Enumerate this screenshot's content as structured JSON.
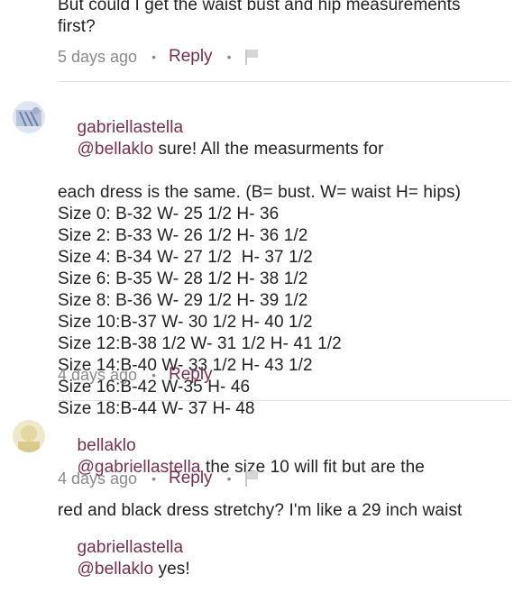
{
  "top_comment": {
    "text_partial_line": "But could I get the waist bust and hip measurements",
    "text_line2": "first?",
    "age": "5 days ago",
    "reply_label": "Reply"
  },
  "comment1": {
    "username": "gabriellastella",
    "mention": "@bellaklo",
    "text_first": " sure! All the measurments for",
    "text_second": "each dress is the same. (B= bust. W= waist H= hips)",
    "sizes": [
      "Size 0: B-32 W- 25 1/2 H- 36",
      "Size 2: B-33 W- 26 1/2 H- 36 1/2",
      "Size 4: B-34 W- 27 1/2  H- 37 1/2",
      "Size 6: B-35 W- 28 1/2 H- 38 1/2",
      "Size 8: B-36 W- 29 1/2 H- 39 1/2",
      "Size 10:B-37 W- 30 1/2 H- 40 1/2",
      "Size 12:B-38 1/2 W- 31 1/2 H- 41 1/2",
      "Size 14:B-40 W- 33 1/2 H- 43 1/2",
      "Size 16:B-42 W-35 H- 46",
      "Size 18:B-44 W- 37 H- 48"
    ],
    "age": "4 days ago",
    "reply_label": "Reply"
  },
  "comment2": {
    "username": "bellaklo",
    "mention": "@gabriellastella",
    "text_first": " the size 10 will fit but are the",
    "text_second": "red and black dress stretchy? I'm like a 29 inch waist",
    "age": "4 days ago",
    "reply_label": "Reply"
  },
  "comment3_partial": {
    "username": "gabriellastella",
    "mention": "@bellaklo",
    "text": " yes!"
  }
}
